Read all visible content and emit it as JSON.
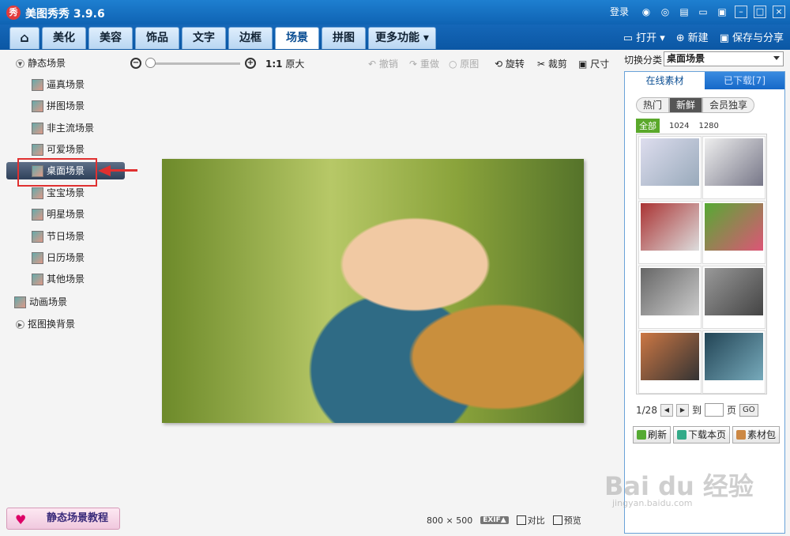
{
  "app": {
    "title": "美图秀秀 3.9.6",
    "logo": "秀"
  },
  "titlebar": {
    "login": "登录"
  },
  "tabs": [
    {
      "label": "⌂",
      "name": "home"
    },
    {
      "label": "美化"
    },
    {
      "label": "美容"
    },
    {
      "label": "饰品"
    },
    {
      "label": "文字"
    },
    {
      "label": "边框"
    },
    {
      "label": "场景",
      "active": true
    },
    {
      "label": "拼图"
    },
    {
      "label": "更多功能 ▾"
    }
  ],
  "tab_actions": {
    "open": "打开",
    "new": "新建",
    "save": "保存与分享"
  },
  "sidebar": {
    "static_cat": "静态场景",
    "items": [
      "逼真场景",
      "拼图场景",
      "非主流场景",
      "可爱场景",
      "桌面场景",
      "宝宝场景",
      "明星场景",
      "节日场景",
      "日历场景",
      "其他场景"
    ],
    "anim_cat": "动画场景",
    "cutout_cat": "抠图换背景",
    "tutorial": "静态场景教程"
  },
  "toolbar": {
    "ratio": "1:1",
    "original": "原大",
    "undo": "撤销",
    "redo": "重做",
    "orig_img": "原图",
    "rotate": "旋转",
    "crop": "裁剪",
    "size": "尺寸"
  },
  "status": {
    "width": "800",
    "x": "×",
    "height": "500",
    "exif": "EXIF▲",
    "compare": "对比",
    "preview": "预览"
  },
  "right": {
    "switch_label": "切换分类",
    "switch_value": "桌面场景",
    "tab_online": "在线素材",
    "tab_downloaded": "已下载[7]",
    "filters": [
      "热门",
      "新鲜",
      "会员独享"
    ],
    "res": [
      "全部",
      "1024",
      "1280"
    ],
    "page": "1/28",
    "goto": "到",
    "page_unit": "页",
    "go": "GO",
    "refresh": "刷新",
    "download_page": "下载本页",
    "pack": "素材包"
  },
  "watermark": {
    "main": "Bai du 经验",
    "sub": "jingyan.baidu.com"
  }
}
